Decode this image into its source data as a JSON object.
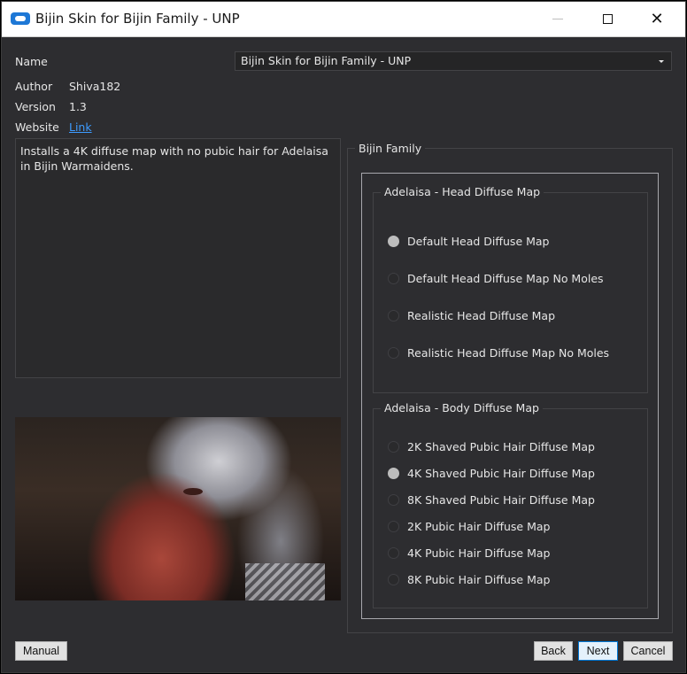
{
  "window": {
    "title": "Bijin Skin for Bijin Family - UNP",
    "icon": "app-logo-icon"
  },
  "info": {
    "name_label": "Name",
    "author_label": "Author",
    "author_value": "Shiva182",
    "version_label": "Version",
    "version_value": "1.3",
    "website_label": "Website",
    "website_link": "Link",
    "selected_plugin": "Bijin Skin for Bijin Family - UNP"
  },
  "description": "Installs a 4K diffuse map with no pubic hair for Adelaisa in Bijin Warmaidens.",
  "options": {
    "group_title": "Bijin Family",
    "head": {
      "title": "Adelaisa - Head Diffuse Map",
      "items": [
        {
          "label": "Default Head Diffuse Map",
          "checked": true
        },
        {
          "label": "Default Head Diffuse Map No Moles",
          "checked": false
        },
        {
          "label": "Realistic Head Diffuse Map",
          "checked": false
        },
        {
          "label": "Realistic Head Diffuse Map No Moles",
          "checked": false
        }
      ]
    },
    "body": {
      "title": "Adelaisa - Body Diffuse Map",
      "items": [
        {
          "label": "2K Shaved Pubic Hair Diffuse Map",
          "checked": false
        },
        {
          "label": "4K Shaved Pubic Hair Diffuse Map",
          "checked": true
        },
        {
          "label": "8K Shaved Pubic Hair Diffuse Map",
          "checked": false
        },
        {
          "label": "2K Pubic Hair Diffuse Map",
          "checked": false
        },
        {
          "label": "4K Pubic Hair Diffuse Map",
          "checked": false
        },
        {
          "label": "8K Pubic Hair Diffuse Map",
          "checked": false
        }
      ]
    }
  },
  "buttons": {
    "manual": "Manual",
    "back": "Back",
    "next": "Next",
    "cancel": "Cancel"
  },
  "colors": {
    "background": "#2d2d30",
    "link": "#3d9bff",
    "accent": "#0078d7"
  }
}
